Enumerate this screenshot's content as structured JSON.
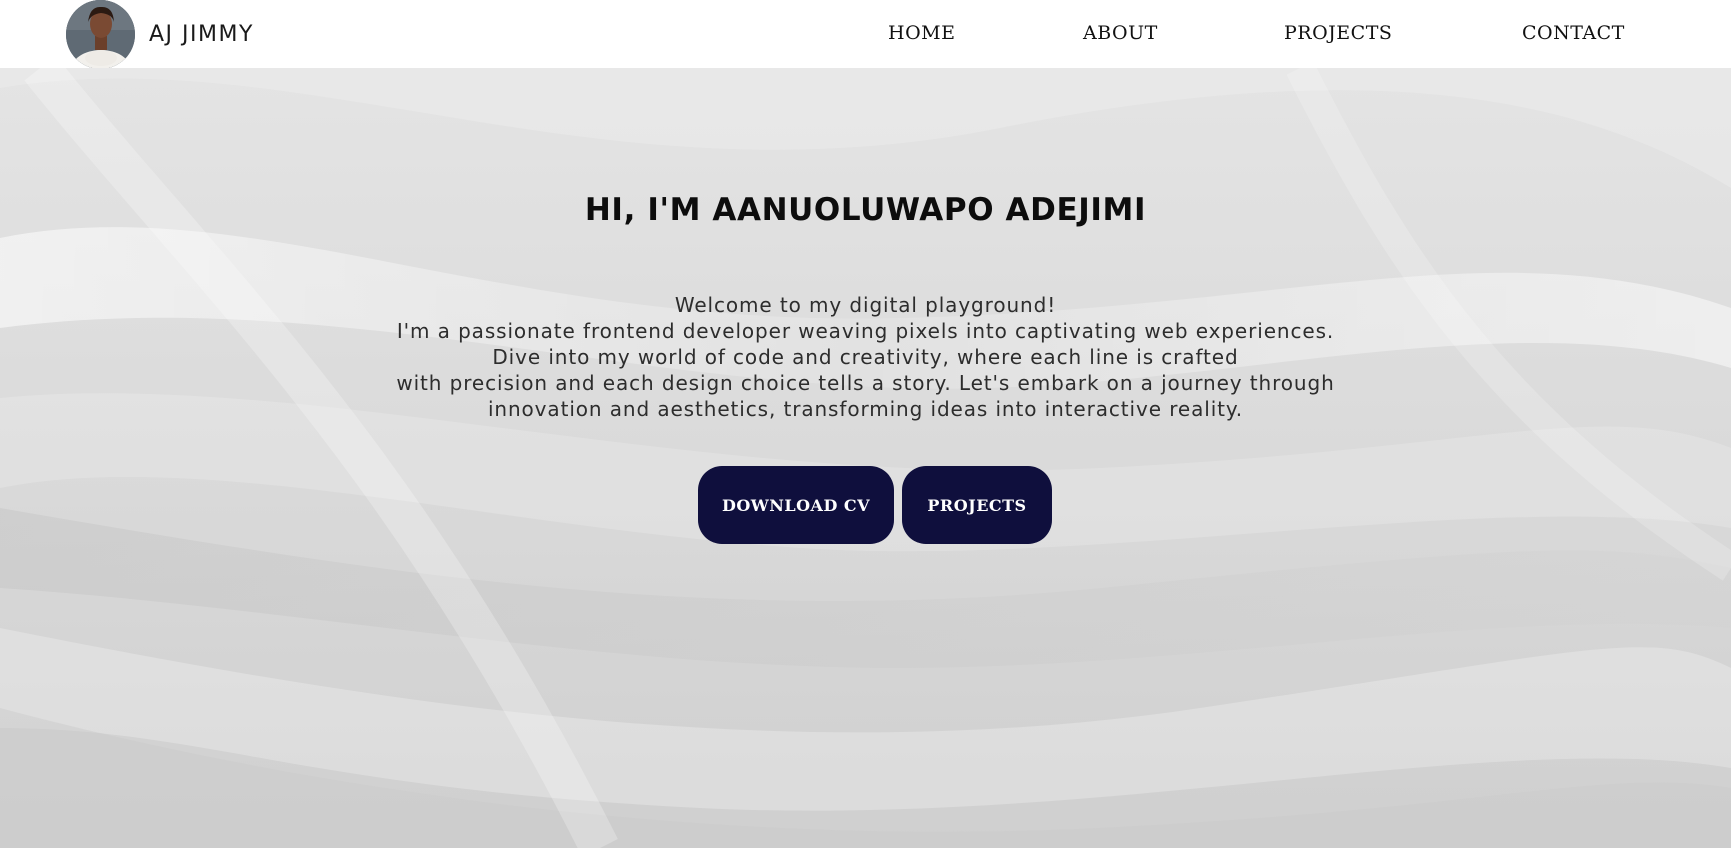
{
  "header": {
    "brand_name": "AJ JIMMY",
    "avatar_icon": "profile-photo",
    "nav": [
      {
        "label": "HOME"
      },
      {
        "label": "ABOUT"
      },
      {
        "label": "PROJECTS"
      },
      {
        "label": "CONTACT"
      }
    ]
  },
  "hero": {
    "title": "HI, I'M AANUOLUWAPO ADEJIMI",
    "lines": [
      "Welcome to my digital playground!",
      "I'm a passionate frontend developer weaving pixels into captivating web experiences.",
      "Dive into my world of code and creativity, where each line is crafted",
      "with precision and each design choice tells a story. Let's embark on a journey through",
      "innovation and aesthetics, transforming ideas into interactive reality."
    ],
    "buttons": {
      "download_cv": "DOWNLOAD CV",
      "projects": "PROJECTS"
    }
  },
  "colors": {
    "button_bg": "#0f0f3d",
    "hero_bg": "#dcdcdc",
    "header_bg": "#ffffff"
  }
}
